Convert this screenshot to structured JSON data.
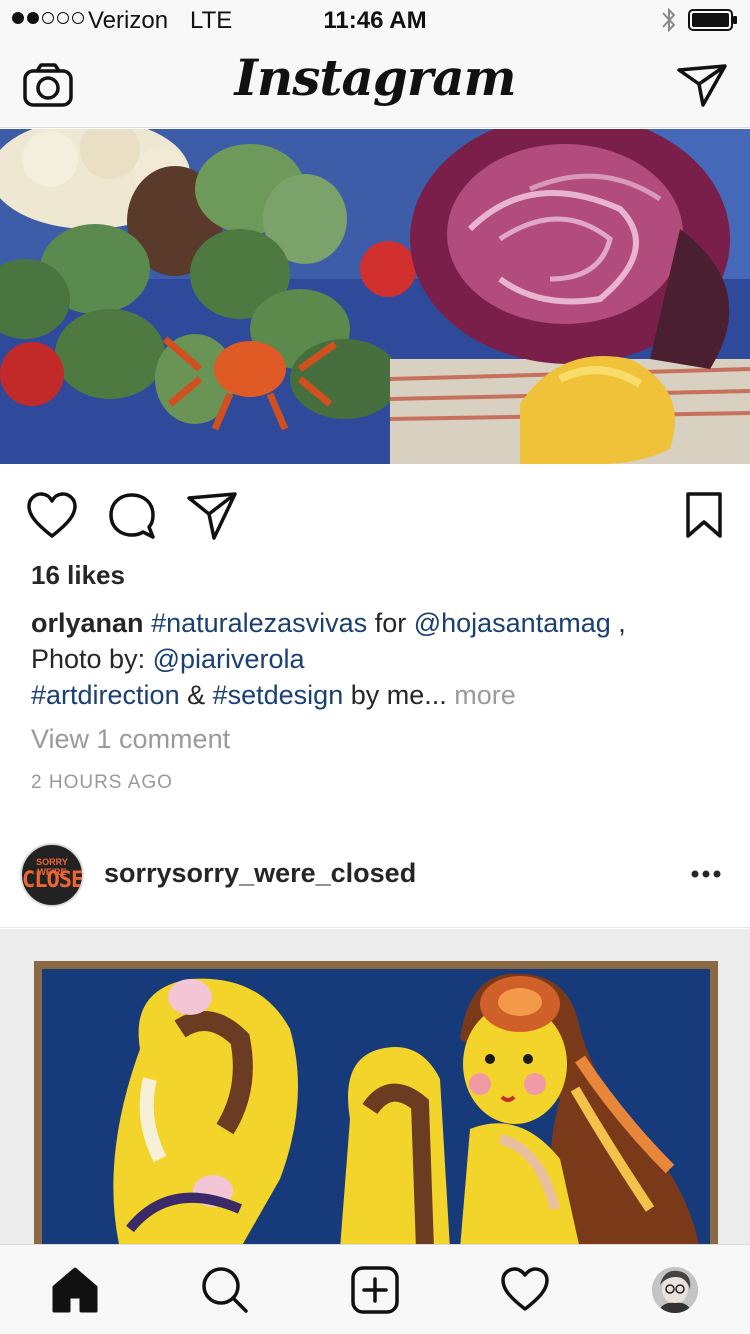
{
  "status_bar": {
    "carrier": "Verizon",
    "network": "LTE",
    "time": "11:46 AM",
    "signal_bars": 2,
    "signal_total": 5,
    "icons": [
      "bluetooth-icon",
      "battery-icon"
    ]
  },
  "nav": {
    "title": "Instagram",
    "left_icon": "camera-icon",
    "right_icon": "direct-message-icon"
  },
  "post1": {
    "actions": [
      "heart-icon",
      "comment-icon",
      "share-icon",
      "bookmark-icon"
    ],
    "likes": "16 likes",
    "caption": {
      "username": "orlyanan",
      "tag1": "#naturalezasvivas",
      "for_text": " for ",
      "mention1": "@hojasantamag",
      "sep": " ,",
      "photo_by": "Photo by: ",
      "mention2": "@piariverola",
      "tag2": "#artdirection",
      "amp": " & ",
      "tag3": "#setdesign",
      "by_me": " by me...",
      "more": "more"
    },
    "view_comments": "View 1 comment",
    "timestamp": "2 HOURS AGO"
  },
  "post2": {
    "username": "sorrysorry_were_closed",
    "avatar_text_top": "SORRY WE'RE",
    "avatar_text_big": "CLOSED",
    "more_icon": "more-options-icon"
  },
  "tab_bar": {
    "items": [
      "home-icon",
      "search-icon",
      "add-post-icon",
      "activity-heart-icon",
      "profile-avatar"
    ]
  },
  "colors": {
    "link": "#1a3f73",
    "muted": "#9a9a9a",
    "text": "#262626",
    "bar_bg": "#f8f8f8"
  }
}
